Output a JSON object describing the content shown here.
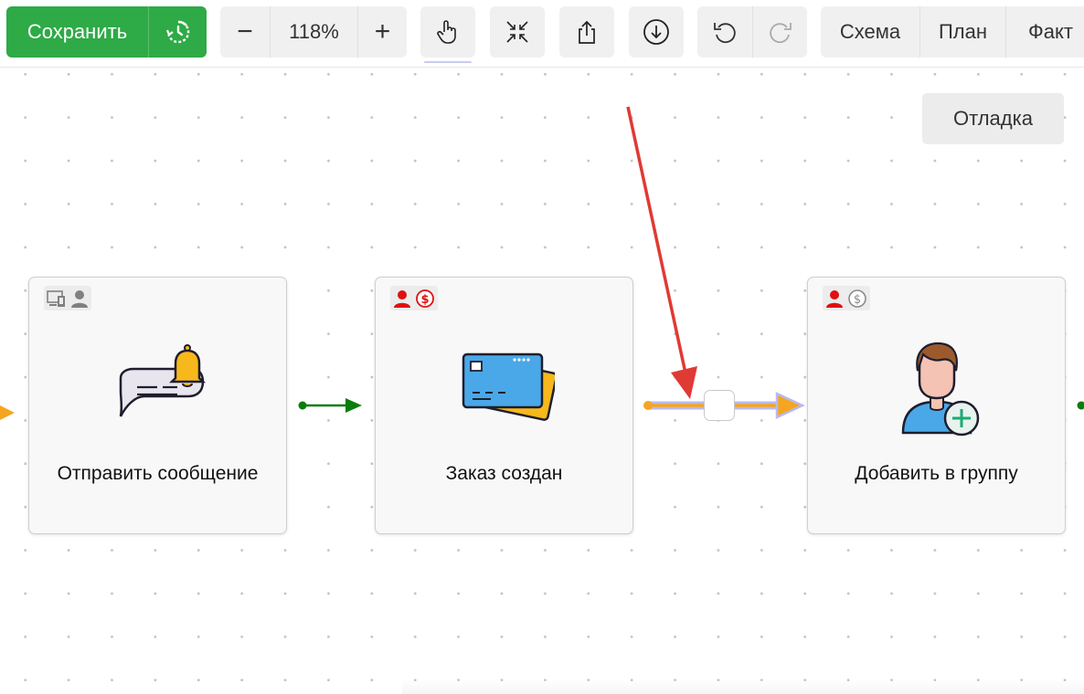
{
  "toolbar": {
    "save_label": "Сохранить",
    "zoom_out": "−",
    "zoom_level": "118%",
    "zoom_in": "+",
    "icons": {
      "history": "history-icon",
      "hand": "hand-pointer-icon",
      "fit": "collapse-icon",
      "export": "share-icon",
      "download": "download-icon",
      "undo": "undo-icon",
      "redo": "redo-icon"
    },
    "view_tabs": [
      "Схема",
      "План",
      "Факт"
    ]
  },
  "canvas": {
    "debug_label": "Отладка",
    "nodes": [
      {
        "title": "Отправить сообщение",
        "badge_icons": [
          "devices-icon",
          "user-icon"
        ],
        "badge_color": "#808080",
        "illustration": "message-bell-icon"
      },
      {
        "title": "Заказ создан",
        "badge_icons": [
          "user-icon",
          "dollar-icon"
        ],
        "badge_color": "#e01010",
        "illustration": "credit-cards-icon"
      },
      {
        "title": "Добавить в группу",
        "badge_icons": [
          "user-icon",
          "dollar-icon"
        ],
        "badge_colors": [
          "#e01010",
          "#8a8a8a"
        ],
        "illustration": "user-add-icon"
      }
    ],
    "connectors": {
      "flow_color": "#0a7d0a",
      "highlight_color": "#f5a51f",
      "selection_color": "#b8baf0",
      "annotation_color": "#e03a34"
    }
  },
  "colors": {
    "save_green": "#2eaa46",
    "toolbar_bg": "#f0f0f0"
  }
}
